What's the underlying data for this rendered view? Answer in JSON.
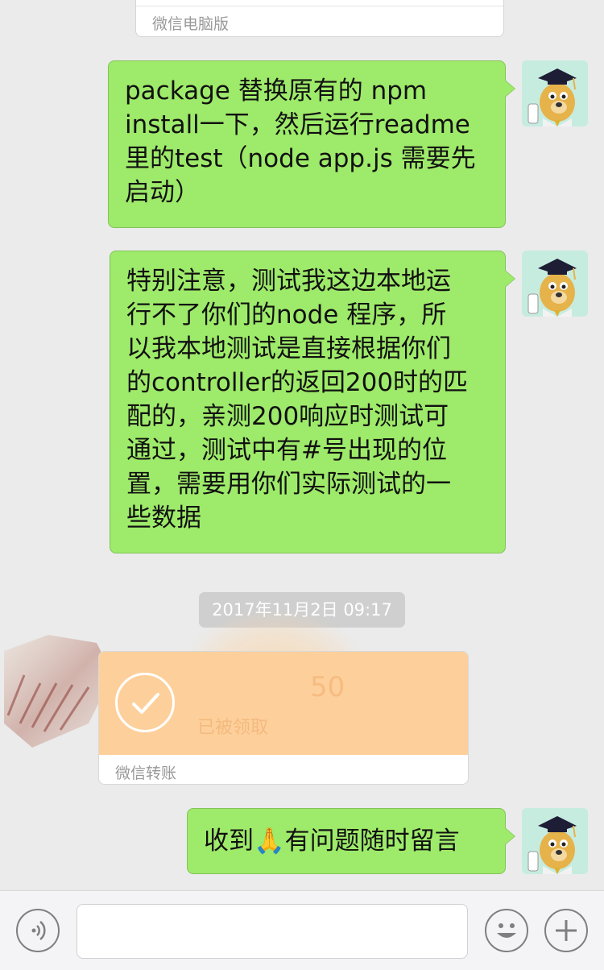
{
  "top_card": {
    "footer": "微信电脑版"
  },
  "messages": [
    {
      "text": "package 替换原有的 npm\ninstall一下，然后运行readme\n里的test（node app.js 需要先\n启动）"
    },
    {
      "text": "特别注意，测试我这边本地运\n行不了你们的node 程序，所\n以我本地测试是直接根据你们\n的controller的返回200时的匹\n配的，亲测200响应时测试可\n通过，测试中有#号出现的位\n置，需要用你们实际测试的一\n些数据"
    },
    {
      "text": "收到🙏有问题随时留言"
    }
  ],
  "timestamp": "2017年11月2日 09:17",
  "transfer": {
    "amount": "50",
    "status": "已被领取",
    "footer": "微信转账",
    "icon": "check-circle-icon"
  },
  "input_bar": {
    "voice_icon": "voice-icon",
    "emoji_icon": "emoji-icon",
    "plus_icon": "plus-icon",
    "input_value": ""
  },
  "colors": {
    "bubble": "#9eea6a",
    "transfer": "#fdd09b",
    "background": "#ebebeb"
  }
}
